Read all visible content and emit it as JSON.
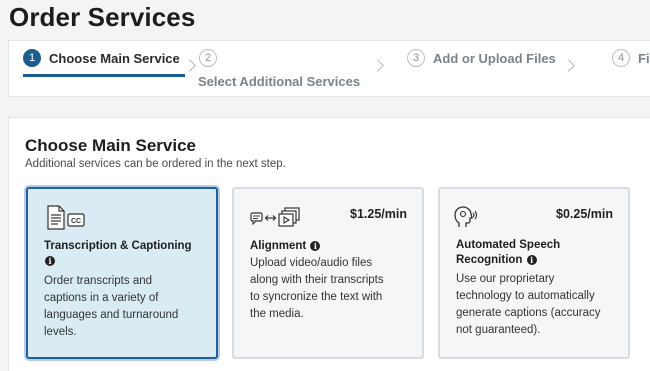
{
  "page": {
    "title": "Order Services"
  },
  "stepper": {
    "steps": [
      {
        "number": "1",
        "label": "Choose Main Service"
      },
      {
        "number": "2",
        "label": "Select Additional Services"
      },
      {
        "number": "3",
        "label": "Add or Upload Files"
      },
      {
        "number": "4",
        "label": "Fi"
      }
    ]
  },
  "main": {
    "title": "Choose Main Service",
    "subtitle": "Additional services can be ordered in the next step.",
    "services": [
      {
        "name": "Transcription & Captioning",
        "description": [
          "Order transcripts and",
          "captions in a variety of",
          "languages and turnaround",
          "levels."
        ],
        "icon": "transcript-cc-icon"
      },
      {
        "name": "Alignment",
        "price": "$1.25/min",
        "description": [
          "Upload video/audio files",
          "along with their transcripts",
          "to syncronize the text with",
          "the media."
        ],
        "icon": "alignment-icon"
      },
      {
        "name_line1": "Automated Speech",
        "name_line2": "Recognition",
        "price": "$0.25/min",
        "description": [
          "Use our proprietary",
          "technology to automatically",
          "generate captions (accuracy",
          "not guaranteed)."
        ],
        "icon": "speech-recognition-icon"
      }
    ]
  },
  "colors": {
    "accent": "#1a5d8e",
    "selected_bg": "#d9ecf4",
    "selected_border": "#1f5fa3"
  }
}
